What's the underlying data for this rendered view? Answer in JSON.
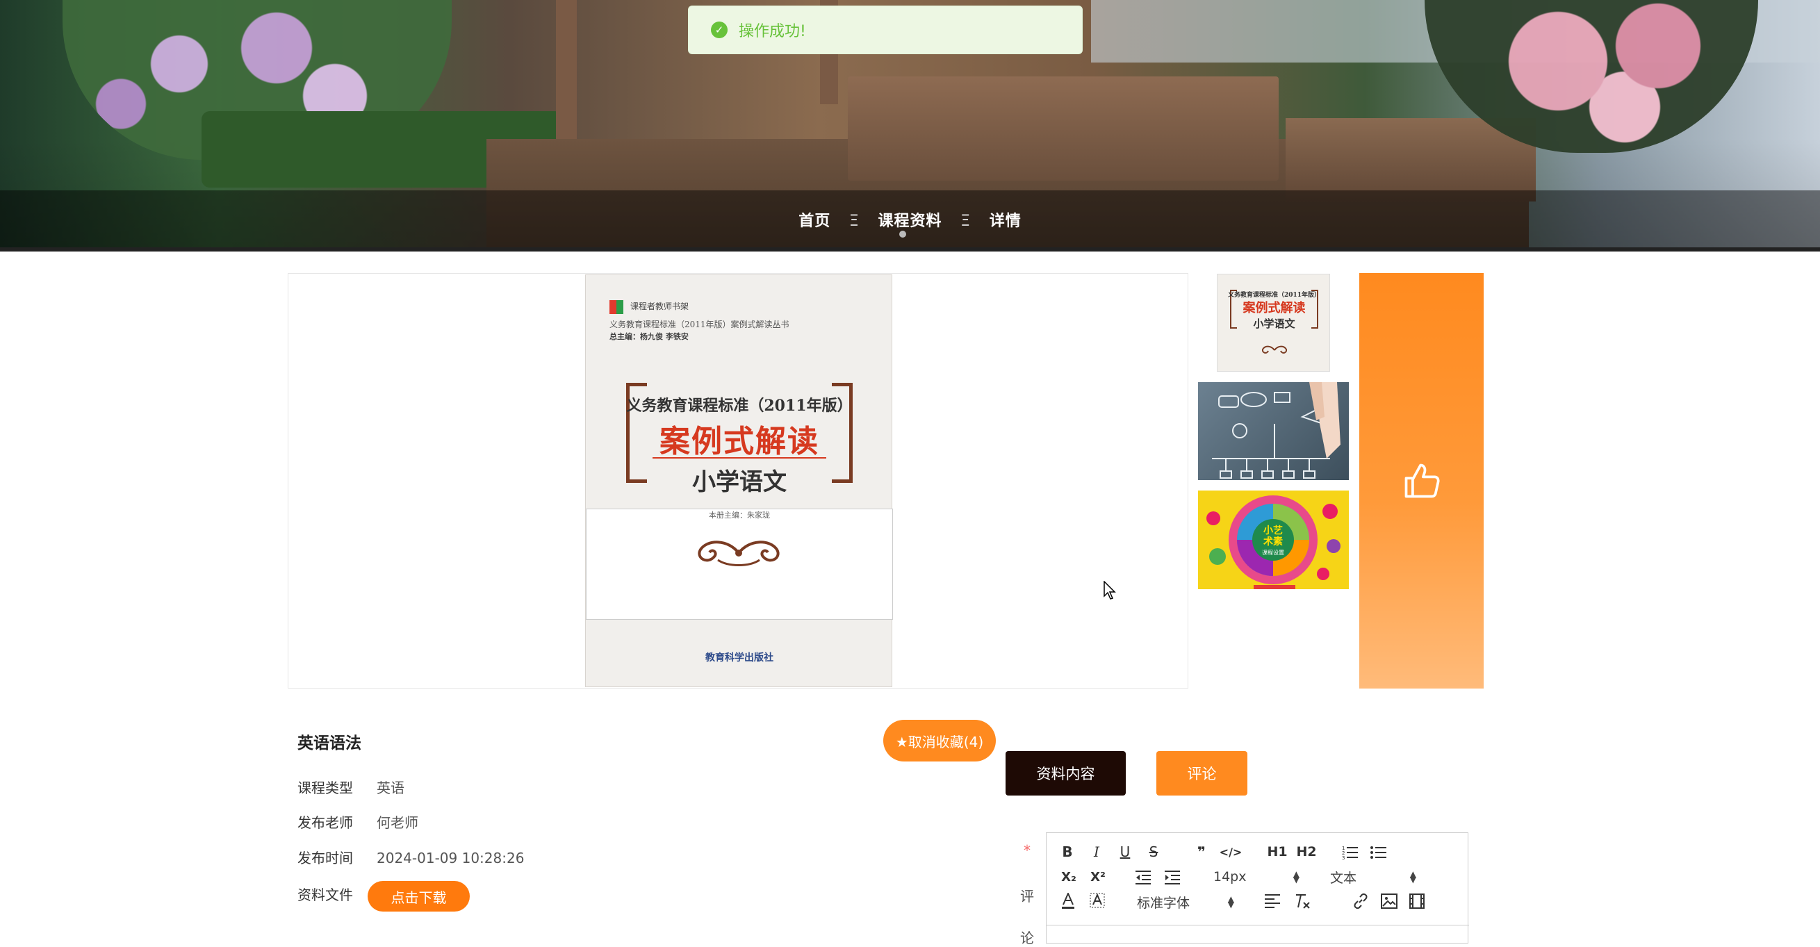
{
  "toast": {
    "message": "操作成功!"
  },
  "breadcrumb": {
    "home": "首页",
    "section": "课程资料",
    "current": "详情",
    "separator": "Ξ"
  },
  "cover": {
    "publisher_brand": "课程者教师书架",
    "series": "义务教育课程标准（2011年版）案例式解读丛书",
    "chief_editors": "总主编：杨九俊  李铁安",
    "title_line1": "义务教育课程标准（2011年版）",
    "title_line2": "案例式解读",
    "title_line3": "小学语文",
    "volume_editor": "本册主编：朱家珑",
    "press": "教育科学出版社"
  },
  "thumbnails": {
    "t1": {
      "line1": "义务教育课程标准（2011年版）",
      "line2": "案例式解读",
      "line3": "小学语文"
    },
    "t3": {
      "center1": "小艺",
      "center2": "术素",
      "center3": "课程设置"
    }
  },
  "info": {
    "title": "英语语法",
    "favorite_button": "★取消收藏(4)",
    "course_type_label": "课程类型",
    "course_type_value": "英语",
    "teacher_label": "发布老师",
    "teacher_value": "何老师",
    "time_label": "发布时间",
    "time_value": "2024-01-09 10:28:26",
    "file_label": "资料文件",
    "download_button": "点击下载"
  },
  "tabs": {
    "content": "资料内容",
    "comment": "评论"
  },
  "form": {
    "required_mark": "*",
    "label_char1": "评",
    "label_char2": "论"
  },
  "editor": {
    "bold": "B",
    "italic": "I",
    "underline": "U",
    "strike": "S",
    "quote": "❞",
    "code": "</>",
    "h1": "H1",
    "h2": "H2",
    "sub": "X₂",
    "sup": "X²",
    "font_size": "14px",
    "header_select": "文本",
    "font_family": "标准字体"
  },
  "colors": {
    "accent": "#ff8a1f",
    "dark_tab": "#1e0a05",
    "success": "#67c23a"
  }
}
